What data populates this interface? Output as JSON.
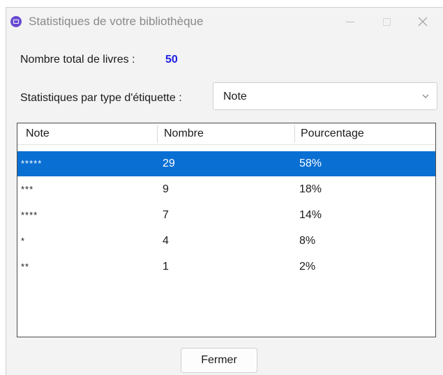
{
  "window": {
    "title": "Statistiques de votre bibliothèque"
  },
  "summary": {
    "total_label": "Nombre total de livres :",
    "total_value": "50"
  },
  "filter": {
    "label": "Statistiques par type d'étiquette :",
    "selected": "Note"
  },
  "table": {
    "headers": [
      "Note",
      "Nombre",
      "Pourcentage"
    ],
    "selected_row": 0,
    "rows": [
      {
        "note": "*****",
        "count": "29",
        "percent": "58%"
      },
      {
        "note": "***",
        "count": "9",
        "percent": "18%"
      },
      {
        "note": "****",
        "count": "7",
        "percent": "14%"
      },
      {
        "note": "*",
        "count": "4",
        "percent": "8%"
      },
      {
        "note": "**",
        "count": "1",
        "percent": "2%"
      }
    ]
  },
  "footer": {
    "close_label": "Fermer"
  },
  "colors": {
    "selection": "#0a6fd3",
    "total_value": "#1e1ee6",
    "app_icon": "#6a4bd0"
  }
}
